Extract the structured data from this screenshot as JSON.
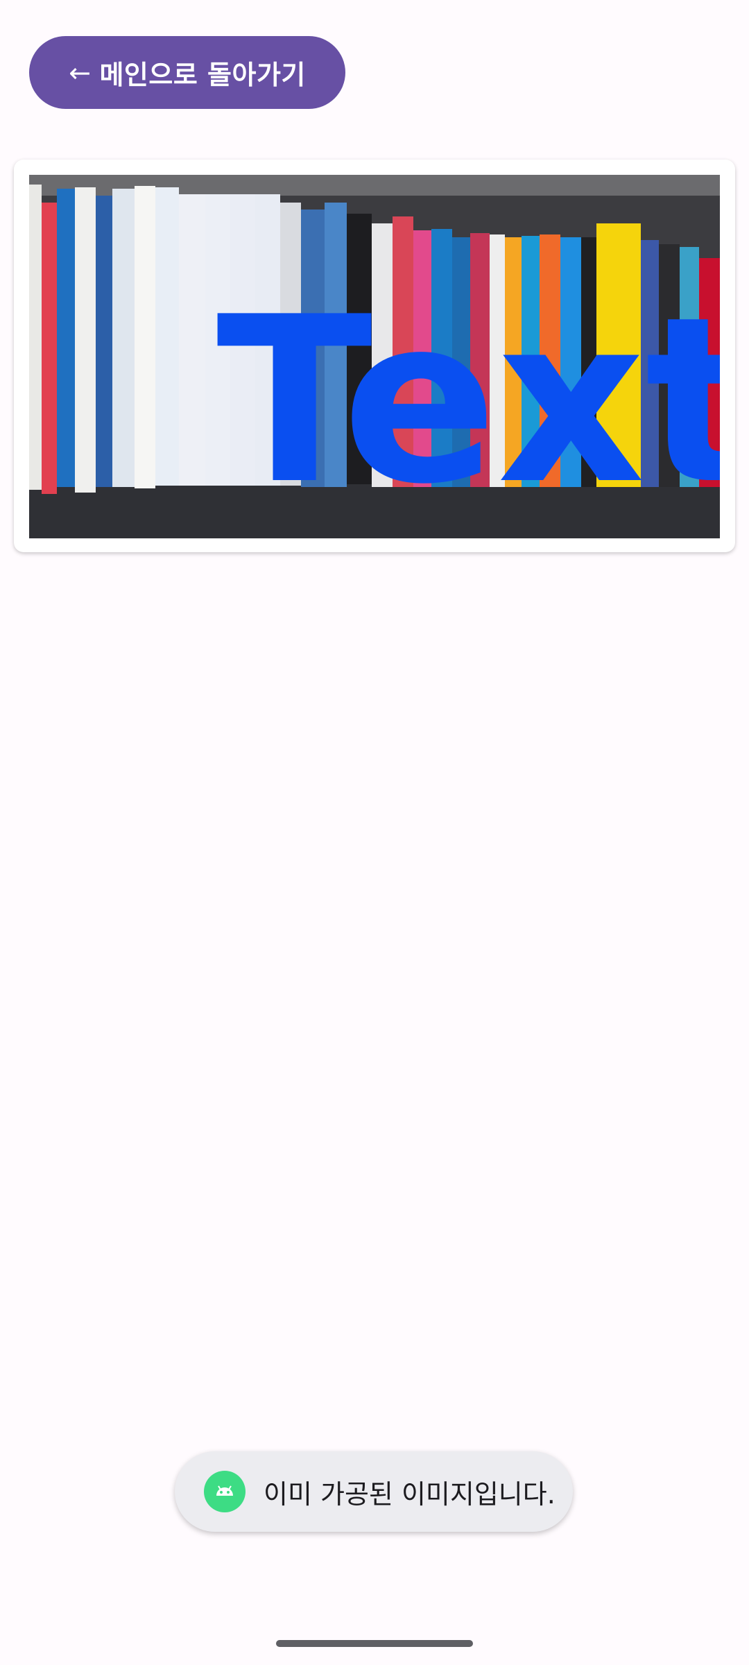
{
  "header": {
    "back_arrow": "←",
    "back_label": "메인으로 돌아가기"
  },
  "image": {
    "description_icon": "processed-image",
    "overlay_text": "Text",
    "overlay_color": "#0a4ff0"
  },
  "toast": {
    "icon": "android-icon",
    "message": "이미 가공된 이미지입니다."
  },
  "colors": {
    "primary": "#6750a4",
    "background": "#fffbfe",
    "toast_bg": "#ececf0"
  }
}
